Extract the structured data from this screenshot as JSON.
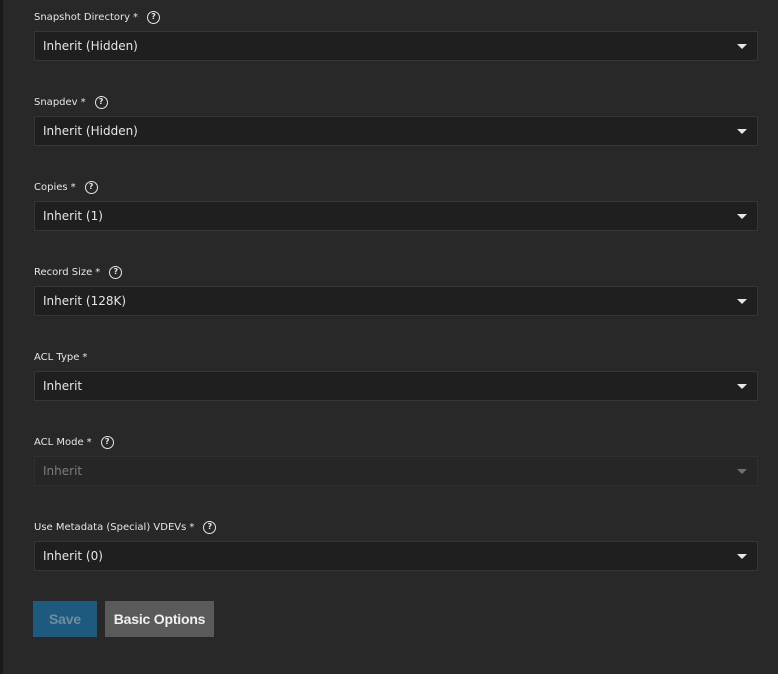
{
  "fields": [
    {
      "label": "Snapshot Directory",
      "required_mark": "*",
      "value": "Inherit (Hidden)",
      "has_help": true,
      "disabled": false
    },
    {
      "label": "Snapdev",
      "required_mark": "*",
      "value": "Inherit (Hidden)",
      "has_help": true,
      "disabled": false
    },
    {
      "label": "Copies",
      "required_mark": "*",
      "value": "Inherit (1)",
      "has_help": true,
      "disabled": false
    },
    {
      "label": "Record Size",
      "required_mark": "*",
      "value": "Inherit (128K)",
      "has_help": true,
      "disabled": false
    },
    {
      "label": "ACL Type",
      "required_mark": "*",
      "value": "Inherit",
      "has_help": false,
      "disabled": false
    },
    {
      "label": "ACL Mode",
      "required_mark": "*",
      "value": "Inherit",
      "has_help": true,
      "disabled": true
    },
    {
      "label": "Use Metadata (Special) VDEVs",
      "required_mark": "*",
      "value": "Inherit (0)",
      "has_help": true,
      "disabled": false
    }
  ],
  "help_glyph": "?",
  "buttons": {
    "save_label": "Save",
    "basic_options_label": "Basic Options"
  },
  "colors": {
    "background": "#282828",
    "select_bg": "#1f1f1f",
    "save_button": "#1d5a7e",
    "basic_button": "#5a5a5a"
  }
}
